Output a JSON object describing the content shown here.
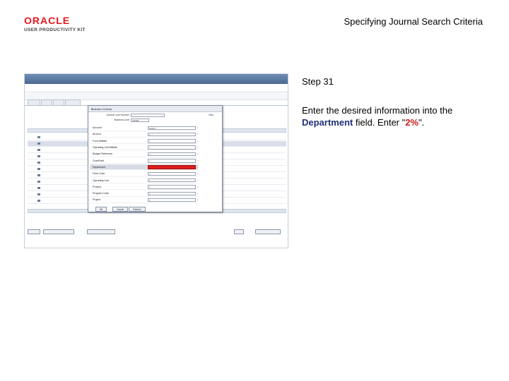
{
  "header": {
    "logo_oracle": "ORACLE",
    "logo_upk": "USER PRODUCTIVITY KIT",
    "doc_title": "Specifying Journal Search Criteria"
  },
  "instruction": {
    "step": "Step 31",
    "text_before": "Enter the desired information into the ",
    "field": "Department",
    "text_mid": " field. Enter \"",
    "value": "2%",
    "text_after": "\"."
  },
  "modal": {
    "title": "Selection Criteria",
    "help_link": "Help",
    "header_fields": [
      {
        "label": "Journal Line Number",
        "value": ""
      },
      {
        "label": "Business Unit",
        "value": "US005"
      }
    ],
    "rows": [
      {
        "label": "Account",
        "operator": "begins",
        "highlight": false,
        "red": false
      },
      {
        "label": "Alt Acct",
        "operator": "=",
        "highlight": false,
        "red": false
      },
      {
        "label": "Fund Affiliate",
        "operator": "=",
        "highlight": false,
        "red": false
      },
      {
        "label": "Operating Unit Affiliate",
        "operator": "=",
        "highlight": false,
        "red": false
      },
      {
        "label": "Budget Reference",
        "operator": "=",
        "highlight": false,
        "red": false
      },
      {
        "label": "ChartField",
        "operator": "=",
        "highlight": false,
        "red": false
      },
      {
        "label": "Department",
        "operator": "",
        "highlight": true,
        "red": true
      },
      {
        "label": "Fund Code",
        "operator": "=",
        "highlight": false,
        "red": false
      },
      {
        "label": "Operating Unit",
        "operator": "=",
        "highlight": false,
        "red": false
      },
      {
        "label": "Product",
        "operator": "=",
        "highlight": false,
        "red": false
      },
      {
        "label": "Program Code",
        "operator": "=",
        "highlight": false,
        "red": false
      },
      {
        "label": "Project",
        "operator": "=",
        "highlight": false,
        "red": false
      }
    ],
    "buttons": [
      "OK",
      "Cancel",
      "Refresh"
    ]
  }
}
